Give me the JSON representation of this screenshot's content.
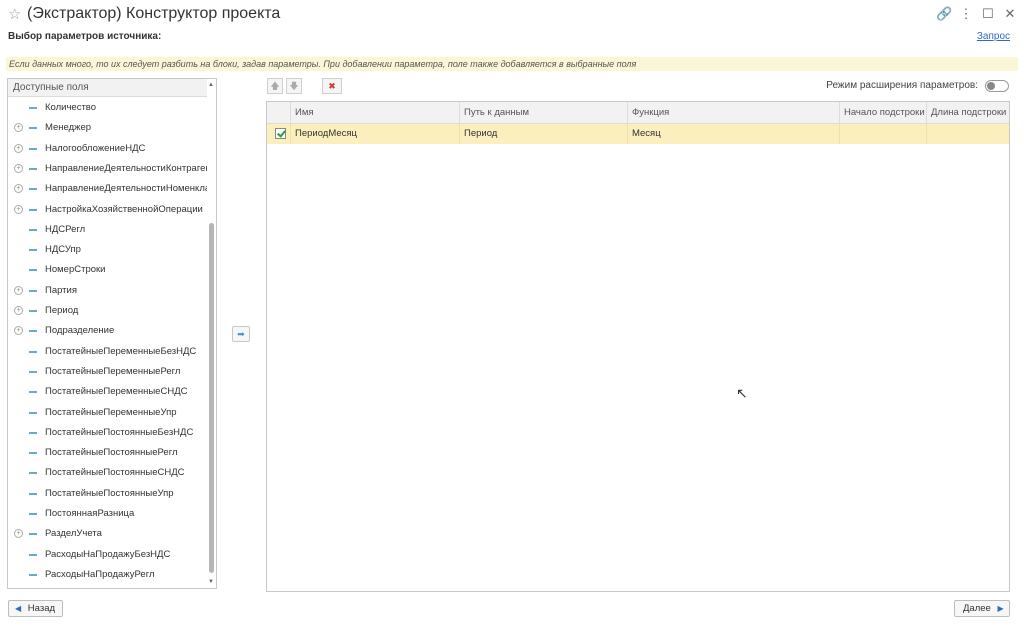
{
  "window": {
    "title": "(Экстрактор) Конструктор проекта",
    "star_icon": "☆",
    "link_icon": "🔗",
    "more_icon": "⋮",
    "maximize_icon": "☐",
    "close_icon": "✕"
  },
  "header": {
    "subtitle": "Выбор параметров источника:",
    "help_link": "Запрос",
    "hint": "Если данных много, то их следует разбить на блоки, задав параметры. При добавлении параметра, поле также добавляется в выбранные поля"
  },
  "left_panel": {
    "header": "Доступные поля",
    "items": [
      {
        "label": "Количество",
        "expandable": false
      },
      {
        "label": "Менеджер",
        "expandable": true
      },
      {
        "label": "НалогообложениеНДС",
        "expandable": true
      },
      {
        "label": "НаправлениеДеятельностиКонтрагента",
        "expandable": true
      },
      {
        "label": "НаправлениеДеятельностиНоменклат...",
        "expandable": true
      },
      {
        "label": "НастройкаХозяйственнойОперации",
        "expandable": true
      },
      {
        "label": "НДСРегл",
        "expandable": false
      },
      {
        "label": "НДСУпр",
        "expandable": false
      },
      {
        "label": "НомерСтроки",
        "expandable": false
      },
      {
        "label": "Партия",
        "expandable": true
      },
      {
        "label": "Период",
        "expandable": true
      },
      {
        "label": "Подразделение",
        "expandable": true
      },
      {
        "label": "ПостатейныеПеременныеБезНДС",
        "expandable": false
      },
      {
        "label": "ПостатейныеПеременныеРегл",
        "expandable": false
      },
      {
        "label": "ПостатейныеПеременныеСНДС",
        "expandable": false
      },
      {
        "label": "ПостатейныеПеременныеУпр",
        "expandable": false
      },
      {
        "label": "ПостатейныеПостоянныеБезНДС",
        "expandable": false
      },
      {
        "label": "ПостатейныеПостоянныеРегл",
        "expandable": false
      },
      {
        "label": "ПостатейныеПостоянныеСНДС",
        "expandable": false
      },
      {
        "label": "ПостатейныеПостоянныеУпр",
        "expandable": false
      },
      {
        "label": "ПостояннаяРазница",
        "expandable": false
      },
      {
        "label": "РазделУчета",
        "expandable": true
      },
      {
        "label": "РасходыНаПродажуБезНДС",
        "expandable": false
      },
      {
        "label": "РасходыНаПродажуРегл",
        "expandable": false
      }
    ]
  },
  "toolbar": {
    "up_icon": "🡅",
    "down_icon": "🡇",
    "delete_icon": "✖",
    "mode_label": "Режим расширения параметров:"
  },
  "grid": {
    "columns": [
      "Имя",
      "Путь к данным",
      "Функция",
      "Начало подстроки",
      "Длина подстроки"
    ],
    "rows": [
      {
        "checked": true,
        "name": "ПериодМесяц",
        "path": "Период",
        "function": "Месяц",
        "start": "",
        "length": ""
      }
    ]
  },
  "bottom": {
    "back_label": "Назад",
    "next_label": "Далее",
    "back_arrow": "◀",
    "next_arrow": "▶"
  },
  "move_right_icon": "➡"
}
